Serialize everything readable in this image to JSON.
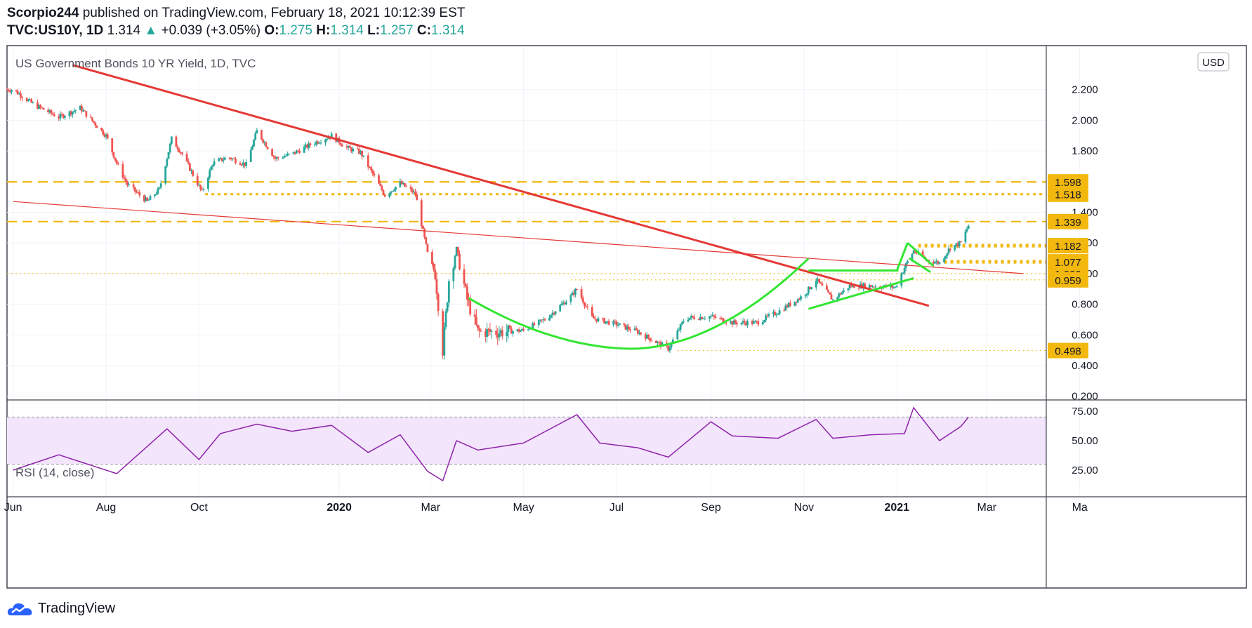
{
  "header": {
    "author": "Scorpio244",
    "published": "published on TradingView.com, February 18, 2021 10:12:39 EST",
    "symbol": "TVC:US10Y, 1D",
    "last": "1.314",
    "change": "+0.039 (+3.05%)",
    "o_label": "O:",
    "o_value": "1.275",
    "h_label": "H:",
    "h_value": "1.314",
    "l_label": "L:",
    "l_value": "1.257",
    "c_label": "C:",
    "c_value": "1.314"
  },
  "footer": {
    "brand": "TradingView"
  },
  "colors": {
    "up": "#26a69a",
    "down": "#ef5350",
    "trend_red": "#e53935",
    "pattern_green": "#33e633",
    "level_gold": "#f2b80e",
    "rsi_line": "#8e24aa",
    "rsi_band": "#f3e5fb"
  },
  "chart_data": [
    {
      "type": "candlestick",
      "title": "US Government Bonds 10 YR Yield, 1D, TVC",
      "currency_badge": "USD",
      "x_tick_labels": [
        "Jun",
        "Aug",
        "Oct",
        "2020",
        "Mar",
        "May",
        "Jul",
        "Sep",
        "Nov",
        "2021",
        "Mar",
        "Ma"
      ],
      "y_tick_labels": [
        "2.200",
        "2.000",
        "1.800",
        "1.400",
        "1.200",
        "1.000",
        "0.800",
        "0.600",
        "0.400",
        "0.200"
      ],
      "ylim": [
        0.2,
        2.4
      ],
      "grid": true,
      "key_levels": [
        {
          "value": 1.598,
          "label": "1.598",
          "style": "dashed"
        },
        {
          "value": 1.518,
          "label": "1.518",
          "style": "dotted"
        },
        {
          "value": 1.339,
          "label": "1.339",
          "style": "dashed"
        },
        {
          "value": 1.182,
          "label": "1.182",
          "style": "dotted"
        },
        {
          "value": 1.077,
          "label": "1.077",
          "style": "dotted"
        },
        {
          "value": 1.0,
          "label": "1.000",
          "style": "fine-dotted"
        },
        {
          "value": 0.959,
          "label": "0.959",
          "style": "fine-dotted"
        },
        {
          "value": 0.498,
          "label": "0.498",
          "style": "fine-dotted"
        }
      ],
      "last_value": 1.314,
      "close_series": {
        "x": [
          "2019-06-01",
          "2019-06-15",
          "2019-07-01",
          "2019-07-15",
          "2019-08-01",
          "2019-08-08",
          "2019-08-15",
          "2019-08-28",
          "2019-09-05",
          "2019-09-13",
          "2019-09-20",
          "2019-10-03",
          "2019-10-10",
          "2019-10-20",
          "2019-11-01",
          "2019-11-08",
          "2019-11-20",
          "2019-12-01",
          "2019-12-15",
          "2019-12-27",
          "2020-01-06",
          "2020-01-15",
          "2020-01-31",
          "2020-02-10",
          "2020-02-20",
          "2020-02-28",
          "2020-03-04",
          "2020-03-09",
          "2020-03-13",
          "2020-03-18",
          "2020-03-25",
          "2020-04-01",
          "2020-04-15",
          "2020-05-01",
          "2020-05-15",
          "2020-06-01",
          "2020-06-05",
          "2020-06-15",
          "2020-07-01",
          "2020-07-15",
          "2020-08-04",
          "2020-08-15",
          "2020-09-01",
          "2020-09-15",
          "2020-10-01",
          "2020-10-15",
          "2020-11-01",
          "2020-11-09",
          "2020-11-20",
          "2020-12-01",
          "2020-12-15",
          "2020-12-31",
          "2021-01-06",
          "2021-01-12",
          "2021-01-20",
          "2021-01-29",
          "2021-02-05",
          "2021-02-12",
          "2021-02-17"
        ],
        "values": [
          2.2,
          2.1,
          2.02,
          2.08,
          1.9,
          1.72,
          1.58,
          1.47,
          1.55,
          1.88,
          1.78,
          1.53,
          1.72,
          1.76,
          1.71,
          1.93,
          1.75,
          1.78,
          1.85,
          1.9,
          1.82,
          1.79,
          1.51,
          1.59,
          1.52,
          1.13,
          1.0,
          0.5,
          0.96,
          1.16,
          0.83,
          0.62,
          0.62,
          0.63,
          0.7,
          0.85,
          0.9,
          0.71,
          0.67,
          0.62,
          0.51,
          0.71,
          0.72,
          0.68,
          0.68,
          0.75,
          0.86,
          0.96,
          0.83,
          0.92,
          0.92,
          0.91,
          1.04,
          1.15,
          1.09,
          1.07,
          1.17,
          1.2,
          1.314
        ]
      },
      "trendlines": [
        "major descending resistance",
        "minor descending line"
      ],
      "patterns": [
        "rounding bottom",
        "ascending triangle",
        "bull flag"
      ]
    },
    {
      "type": "line",
      "title": "RSI (14, close)",
      "y_tick_labels": [
        "75.00",
        "50.00",
        "25.00"
      ],
      "band": [
        30,
        70
      ],
      "ylim": [
        10,
        80
      ],
      "x": [
        "2019-06-01",
        "2019-07-01",
        "2019-08-08",
        "2019-09-10",
        "2019-10-01",
        "2019-10-15",
        "2019-11-08",
        "2019-12-01",
        "2019-12-27",
        "2020-01-20",
        "2020-02-10",
        "2020-02-28",
        "2020-03-09",
        "2020-03-18",
        "2020-04-01",
        "2020-05-01",
        "2020-06-05",
        "2020-06-20",
        "2020-07-15",
        "2020-08-04",
        "2020-09-01",
        "2020-09-15",
        "2020-10-15",
        "2020-11-09",
        "2020-11-20",
        "2020-12-15",
        "2021-01-06",
        "2021-01-12",
        "2021-01-29",
        "2021-02-12",
        "2021-02-17"
      ],
      "values": [
        25,
        38,
        22,
        60,
        34,
        56,
        64,
        58,
        63,
        40,
        55,
        24,
        16,
        50,
        42,
        48,
        72,
        48,
        44,
        36,
        66,
        54,
        52,
        68,
        52,
        55,
        56,
        78,
        50,
        62,
        70
      ]
    }
  ]
}
